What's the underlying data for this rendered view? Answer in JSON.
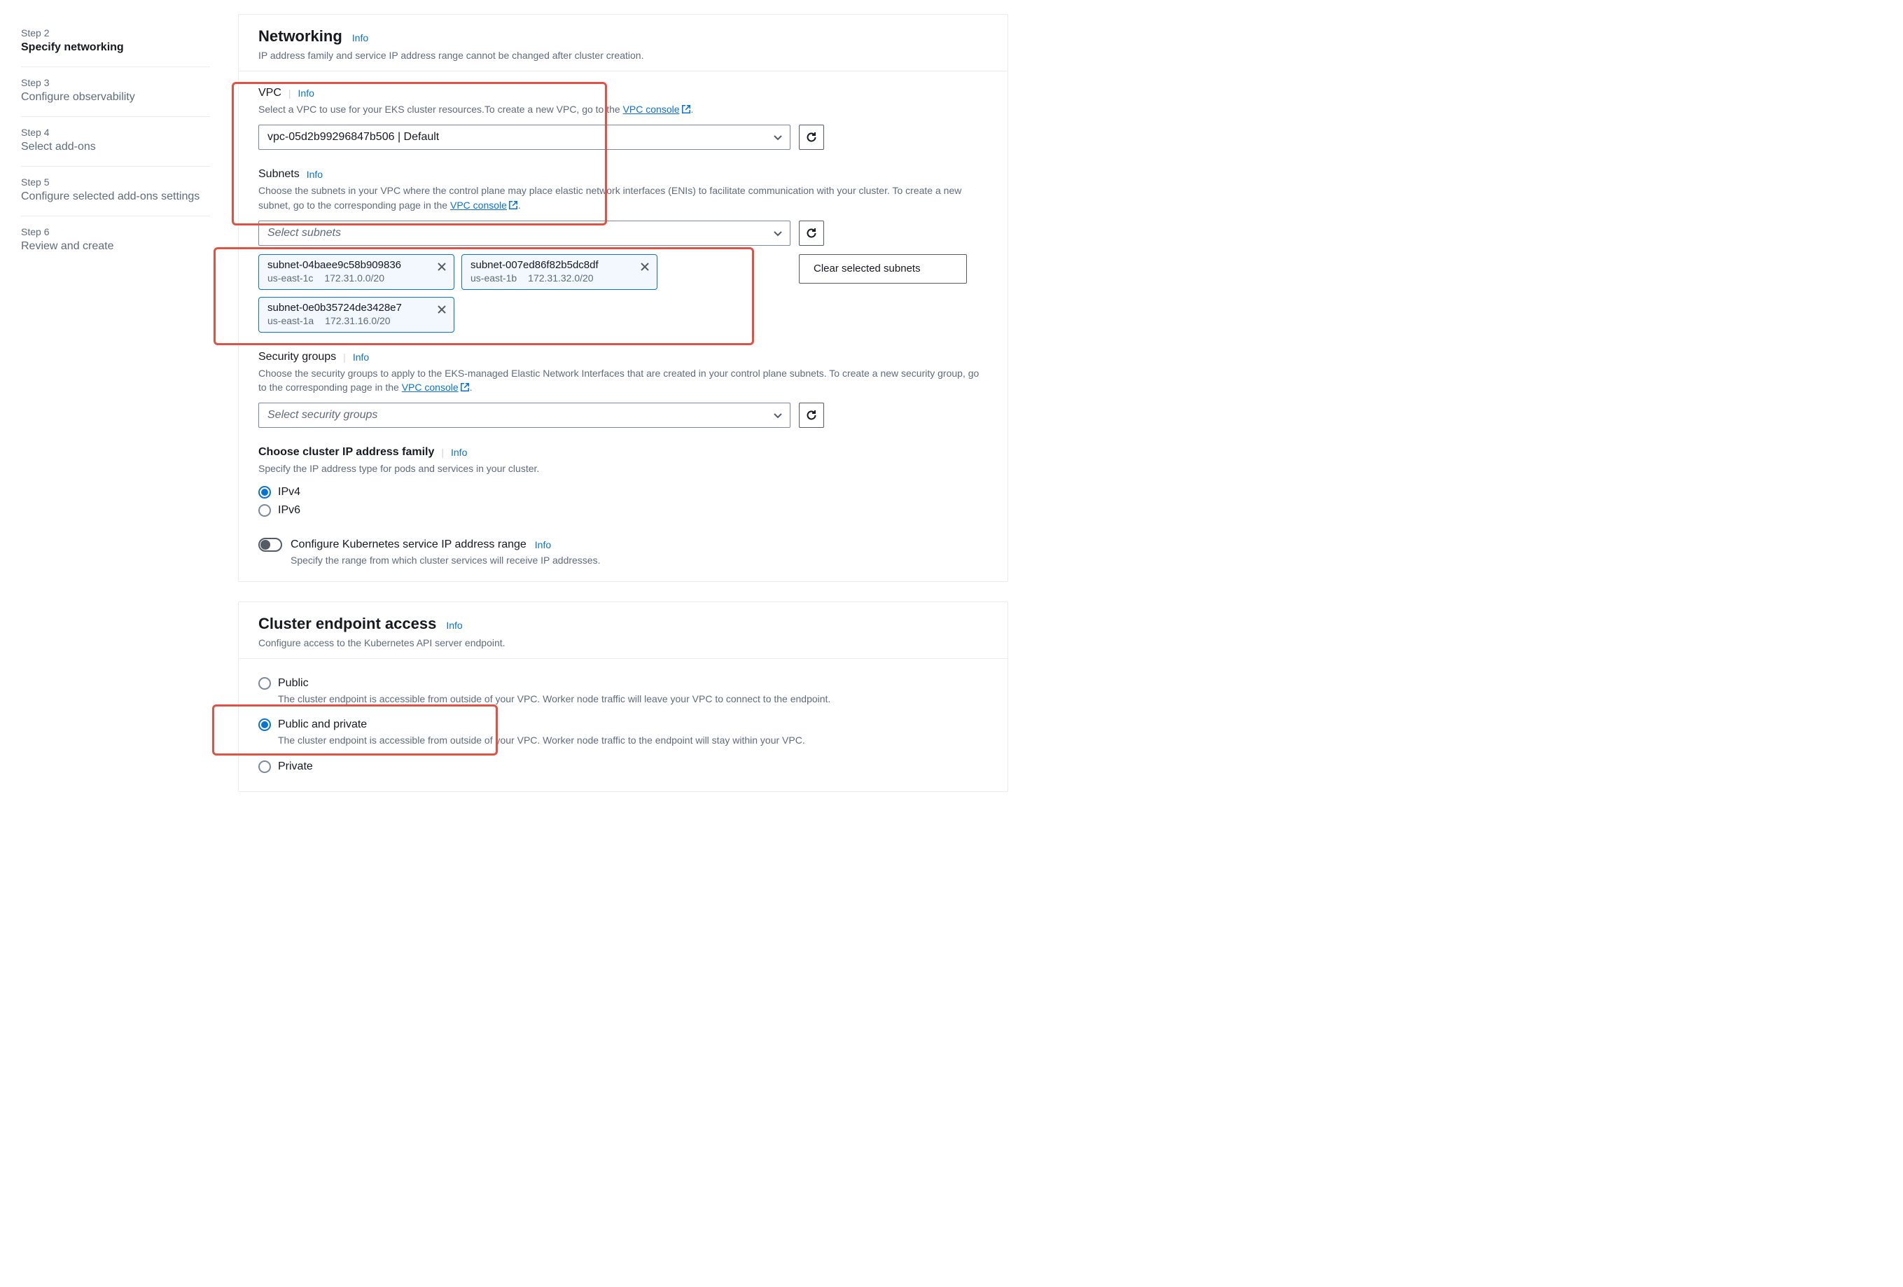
{
  "sidebar": {
    "steps": [
      {
        "num": "Step 2",
        "title": "Specify networking",
        "active": true
      },
      {
        "num": "Step 3",
        "title": "Configure observability",
        "active": false
      },
      {
        "num": "Step 4",
        "title": "Select add-ons",
        "active": false
      },
      {
        "num": "Step 5",
        "title": "Configure selected add-ons settings",
        "active": false
      },
      {
        "num": "Step 6",
        "title": "Review and create",
        "active": false
      }
    ]
  },
  "labels": {
    "info": "Info",
    "vpc_console": "VPC console"
  },
  "networking": {
    "title": "Networking",
    "subtitle": "IP address family and service IP address range cannot be changed after cluster creation.",
    "vpc": {
      "label": "VPC",
      "help_prefix": "Select a VPC to use for your EKS cluster resources.To create a new VPC, go to the ",
      "help_suffix": ".",
      "value": "vpc-05d2b99296847b506 | Default"
    },
    "subnets": {
      "label": "Subnets",
      "help_prefix": "Choose the subnets in your VPC where the control plane may place elastic network interfaces (ENIs) to facilitate communication with your cluster. To create a new subnet, go to the corresponding page in the ",
      "help_suffix": ".",
      "placeholder": "Select subnets",
      "clear": "Clear selected subnets",
      "items": [
        {
          "id": "subnet-04baee9c58b909836",
          "az": "us-east-1c",
          "cidr": "172.31.0.0/20"
        },
        {
          "id": "subnet-007ed86f82b5dc8df",
          "az": "us-east-1b",
          "cidr": "172.31.32.0/20"
        },
        {
          "id": "subnet-0e0b35724de3428e7",
          "az": "us-east-1a",
          "cidr": "172.31.16.0/20"
        }
      ]
    },
    "security_groups": {
      "label": "Security groups",
      "help_prefix": "Choose the security groups to apply to the EKS-managed Elastic Network Interfaces that are created in your control plane subnets. To create a new security group, go to the corresponding page in the ",
      "help_suffix": ".",
      "placeholder": "Select security groups"
    },
    "ip_family": {
      "label": "Choose cluster IP address family",
      "help": "Specify the IP address type for pods and services in your cluster.",
      "options": {
        "ipv4": "IPv4",
        "ipv6": "IPv6"
      },
      "selected": "ipv4"
    },
    "service_range": {
      "label": "Configure Kubernetes service IP address range",
      "help": "Specify the range from which cluster services will receive IP addresses."
    }
  },
  "endpoint": {
    "title": "Cluster endpoint access",
    "subtitle": "Configure access to the Kubernetes API server endpoint.",
    "options": {
      "public": {
        "label": "Public",
        "desc": "The cluster endpoint is accessible from outside of your VPC. Worker node traffic will leave your VPC to connect to the endpoint."
      },
      "public_private": {
        "label": "Public and private",
        "desc": "The cluster endpoint is accessible from outside of your VPC. Worker node traffic to the endpoint will stay within your VPC."
      },
      "private": {
        "label": "Private"
      }
    },
    "selected": "public_private"
  }
}
